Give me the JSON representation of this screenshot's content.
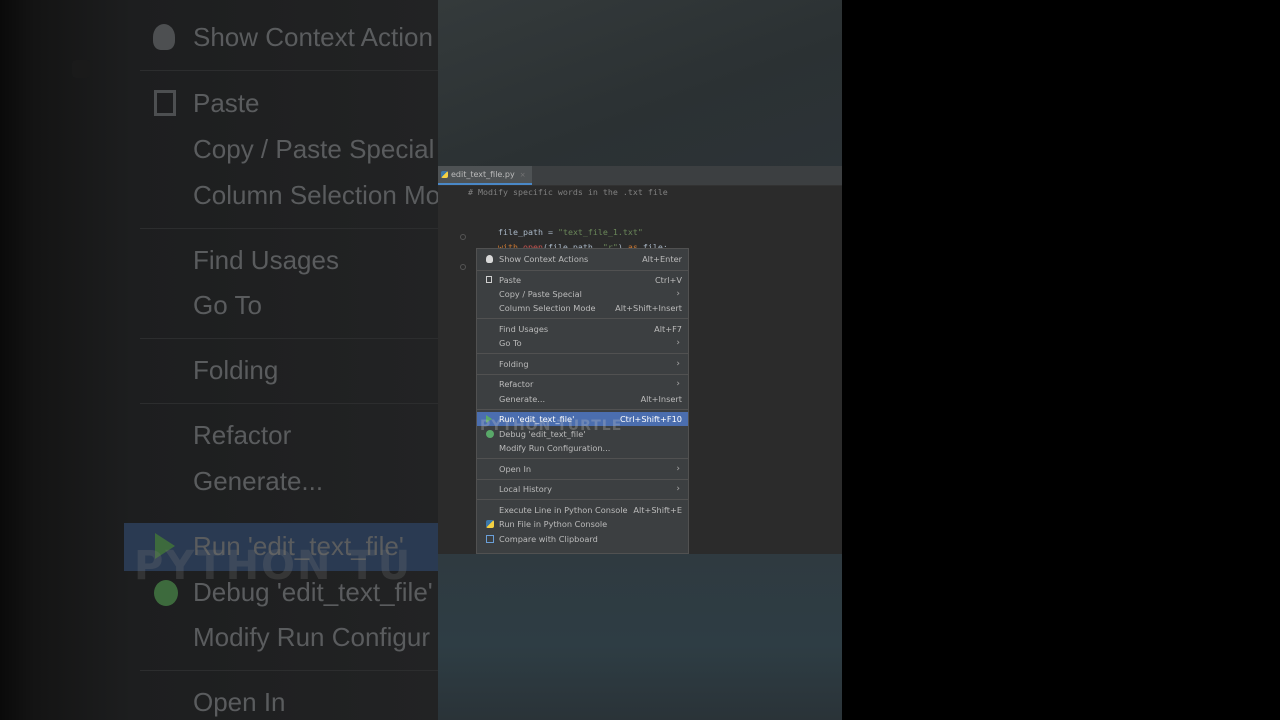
{
  "editor": {
    "tab_title": "edit_text_file.py",
    "tab_close": "×",
    "lines": [
      {
        "text": "# Modify specific words in the .txt file",
        "kind": "comment"
      },
      {
        "text": "",
        "kind": "blank"
      },
      {
        "parts": [
          {
            "t": "file_path",
            "c": "var"
          },
          {
            "t": " = ",
            "c": "var"
          },
          {
            "t": "\"text_file_1.txt\"",
            "c": "str"
          }
        ]
      },
      {
        "parts": [
          {
            "t": "with ",
            "c": "kw"
          },
          {
            "t": "open",
            "c": "fn"
          },
          {
            "t": "(file_path, ",
            "c": "var"
          },
          {
            "t": "\"r\"",
            "c": "str"
          },
          {
            "t": ") ",
            "c": "var"
          },
          {
            "t": "as ",
            "c": "kw"
          },
          {
            "t": "file:",
            "c": "var"
          }
        ]
      }
    ]
  },
  "context_menu": {
    "items": [
      {
        "label": "Show Context Actions",
        "shortcut": "Alt+Enter",
        "icon": "bulb-icon",
        "submenu": false
      },
      {
        "label": "Paste",
        "shortcut": "Ctrl+V",
        "icon": "clipboard-icon",
        "submenu": false
      },
      {
        "label": "Copy / Paste Special",
        "shortcut": "",
        "icon": "",
        "submenu": true
      },
      {
        "label": "Column Selection Mode",
        "shortcut": "Alt+Shift+Insert",
        "icon": "",
        "submenu": false
      },
      {
        "label": "Find Usages",
        "shortcut": "Alt+F7",
        "icon": "",
        "submenu": false
      },
      {
        "label": "Go To",
        "shortcut": "",
        "icon": "",
        "submenu": true
      },
      {
        "label": "Folding",
        "shortcut": "",
        "icon": "",
        "submenu": true
      },
      {
        "label": "Refactor",
        "shortcut": "",
        "icon": "",
        "submenu": true
      },
      {
        "label": "Generate...",
        "shortcut": "Alt+Insert",
        "icon": "",
        "submenu": false
      },
      {
        "label": "Run 'edit_text_file'",
        "shortcut": "Ctrl+Shift+F10",
        "icon": "run-icon",
        "submenu": false,
        "selected": true
      },
      {
        "label": "Debug 'edit_text_file'",
        "shortcut": "",
        "icon": "debug-icon",
        "submenu": false
      },
      {
        "label": "Modify Run Configuration...",
        "shortcut": "",
        "icon": "",
        "submenu": false
      },
      {
        "label": "Open In",
        "shortcut": "",
        "icon": "",
        "submenu": true
      },
      {
        "label": "Local History",
        "shortcut": "",
        "icon": "",
        "submenu": true
      },
      {
        "label": "Execute Line in Python Console",
        "shortcut": "Alt+Shift+E",
        "icon": "",
        "submenu": false
      },
      {
        "label": "Run File in Python Console",
        "shortcut": "",
        "icon": "python-icon",
        "submenu": false
      },
      {
        "label": "Compare with Clipboard",
        "shortcut": "",
        "icon": "compare-icon",
        "submenu": false
      }
    ],
    "submenu_arrow": "›"
  },
  "watermark": "PYTHON TURTLE",
  "background_zoom": {
    "items": [
      "Show Context Action",
      "Paste",
      "Copy / Paste Special",
      "Column Selection Mo",
      "Find Usages",
      "Go To",
      "Folding",
      "Refactor",
      "Generate...",
      "Run 'edit_text_file'",
      "Debug 'edit_text_file'",
      "Modify Run Configur",
      "Open In"
    ],
    "watermark": "PYTHON TU"
  },
  "colors": {
    "editor_bg": "#2b2b2b",
    "menu_bg": "#3c3f41",
    "selection": "#4b6eaf",
    "run_icon": "#59a869"
  }
}
